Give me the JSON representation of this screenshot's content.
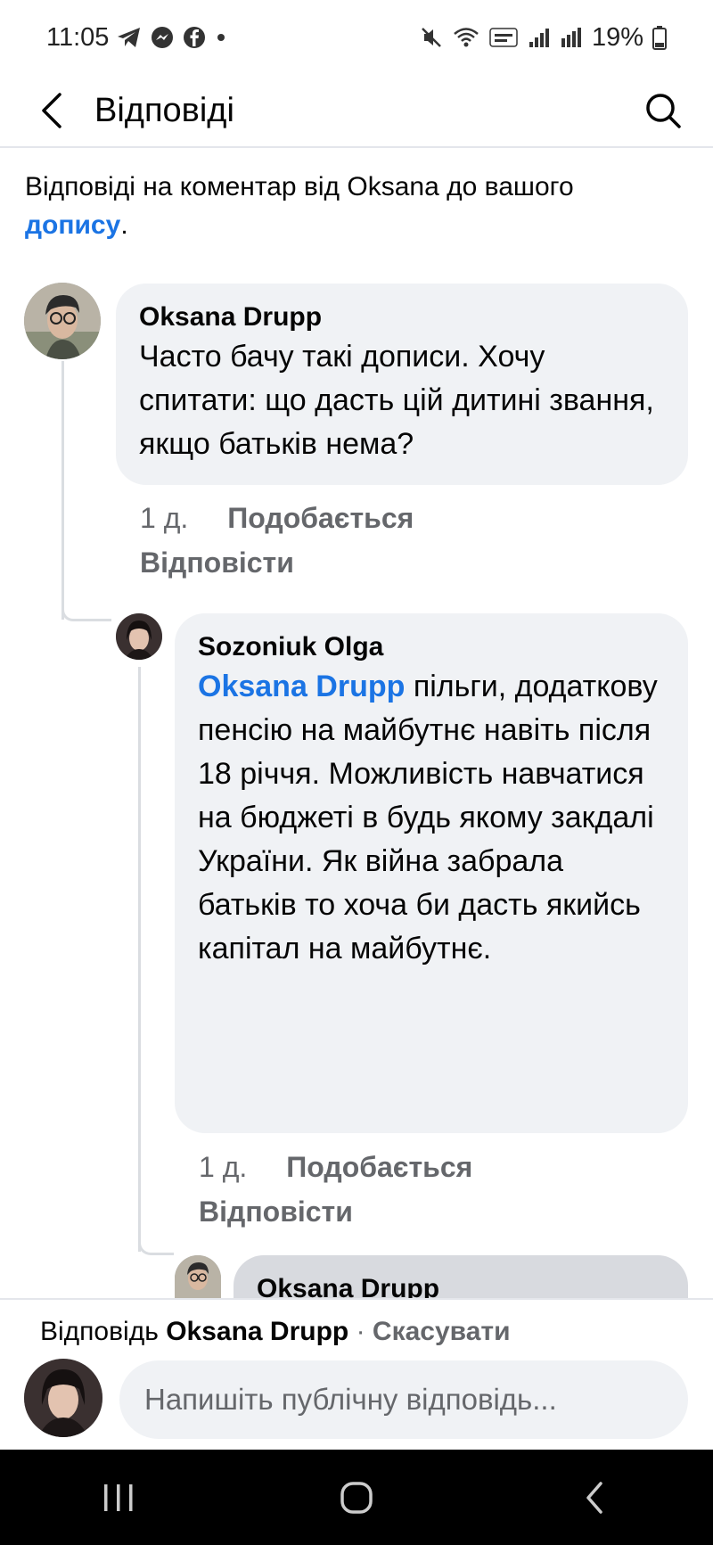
{
  "status_bar": {
    "time": "11:05",
    "battery": "19%"
  },
  "header": {
    "title": "Відповіді"
  },
  "context": {
    "prefix": "Відповіді на коментар від Oksana до вашого ",
    "link": "допису",
    "suffix": "."
  },
  "comments": [
    {
      "author": "Oksana Drupp",
      "text": "Часто бачу такі дописи. Хочу спитати: що дасть цій дитині звання, якщо батьків нема?",
      "time": "1 д.",
      "like": "Подобається",
      "reply": "Відповісти"
    },
    {
      "author": "Sozoniuk Olga",
      "mention": "Oksana Drupp",
      "text": " пільги, додаткову пенсію на майбутнє навіть після 18 річчя. Можливість навчатися на бюджеті в будь якому закдалі України. Як війна забрала батьків то хоча би дасть якийсь капітал на майбутнє.",
      "time": "1 д.",
      "like": "Подобається",
      "reply": "Відповісти"
    },
    {
      "author": "Oksana Drupp"
    }
  ],
  "reply_bar": {
    "prefix": "Відповідь ",
    "target": "Oksana Drupp",
    "separator": " · ",
    "cancel": "Скасувати",
    "placeholder": "Напишіть публічну відповідь..."
  },
  "icons": {
    "back": "back-arrow-icon",
    "search": "search-icon",
    "nav_recent": "recent-apps-icon",
    "nav_home": "home-icon",
    "nav_back": "nav-back-icon"
  }
}
